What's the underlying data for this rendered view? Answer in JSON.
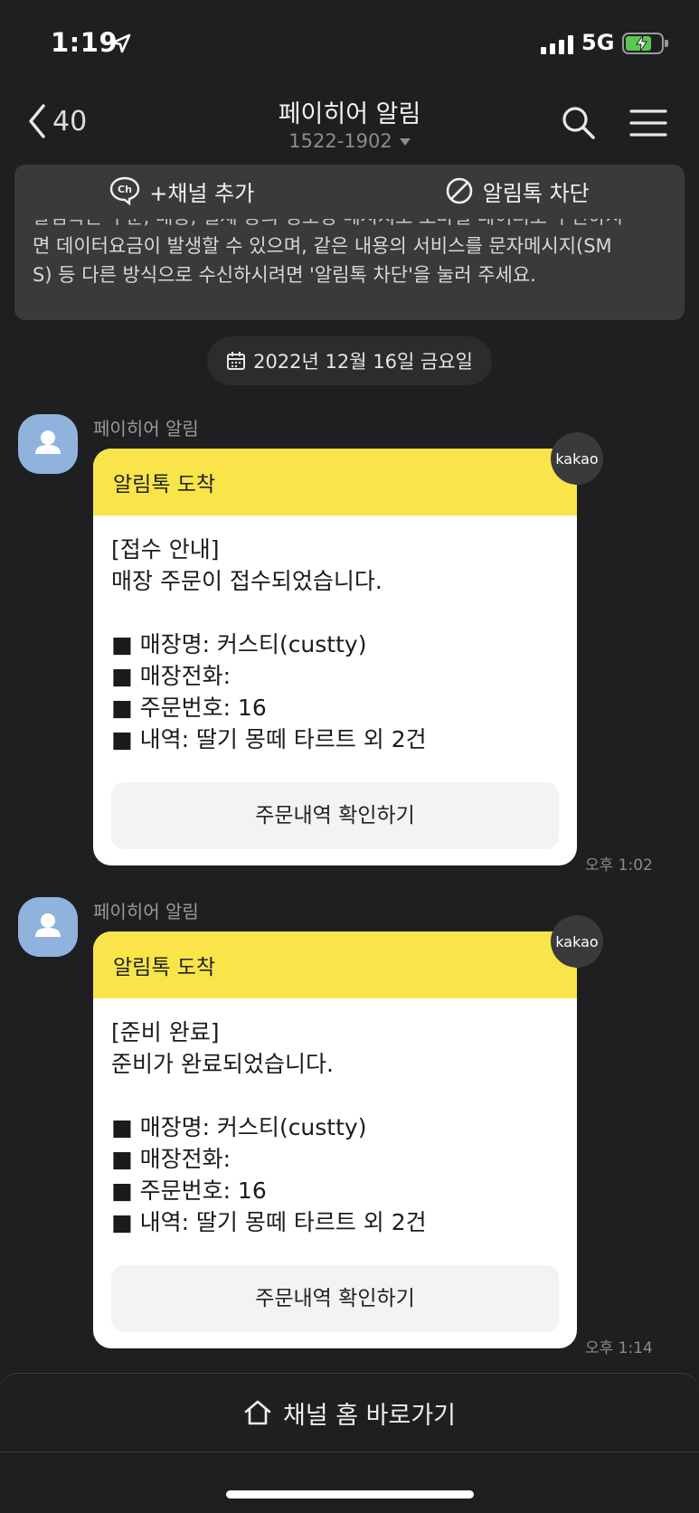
{
  "status_bar": {
    "time": "1:19",
    "network": "5G",
    "signal_bars": 4,
    "battery_level": 0.65,
    "battery_charging": true
  },
  "header": {
    "back_count": "40",
    "title": "페이히어 알림",
    "subtitle": "1522-1902"
  },
  "notice": {
    "add_channel_label": "+채널 추가",
    "block_label": "알림톡 차단",
    "text_cut": "알림톡은 주문, 배송, 결제 등의 정보성 메시지로 모바일 데이터로 수신하시",
    "text_line1": "면 데이터요금이 발생할 수 있으며, 같은 내용의 서비스를 문자메시지(SM",
    "text_line2": "S) 등 다른 방식으로 수신하시려면 '알림톡 차단'을 눌러 주세요."
  },
  "date_divider": "2022년 12월 16일 금요일",
  "messages": [
    {
      "sender": "페이히어 알림",
      "header": "알림톡 도착",
      "badge": "kakao",
      "title": "[접수 안내]",
      "line": "매장 주문이 접수되었습니다.",
      "store_name": "■ 매장명: 커스티(custty)",
      "store_phone": "■ 매장전화:",
      "order_no": "■ 주문번호: 16",
      "items": "■ 내역: 딸기 몽떼 타르트 외 2건",
      "button": "주문내역 확인하기",
      "time": "오후 1:02"
    },
    {
      "sender": "페이히어 알림",
      "header": "알림톡 도착",
      "badge": "kakao",
      "title": "[준비 완료]",
      "line": "준비가 완료되었습니다.",
      "store_name": "■ 매장명: 커스티(custty)",
      "store_phone": "■ 매장전화:",
      "order_no": "■ 주문번호: 16",
      "items": "■ 내역: 딸기 몽떼 타르트 외 2건",
      "button": "주문내역 확인하기",
      "time": "오후 1:14"
    }
  ],
  "bottom_bar": {
    "label": "채널 홈 바로가기"
  },
  "colors": {
    "background": "#1f1f21",
    "bubble_header": "#f9e54a",
    "panel": "#3a3a3c",
    "avatar": "#8fb3dc"
  }
}
